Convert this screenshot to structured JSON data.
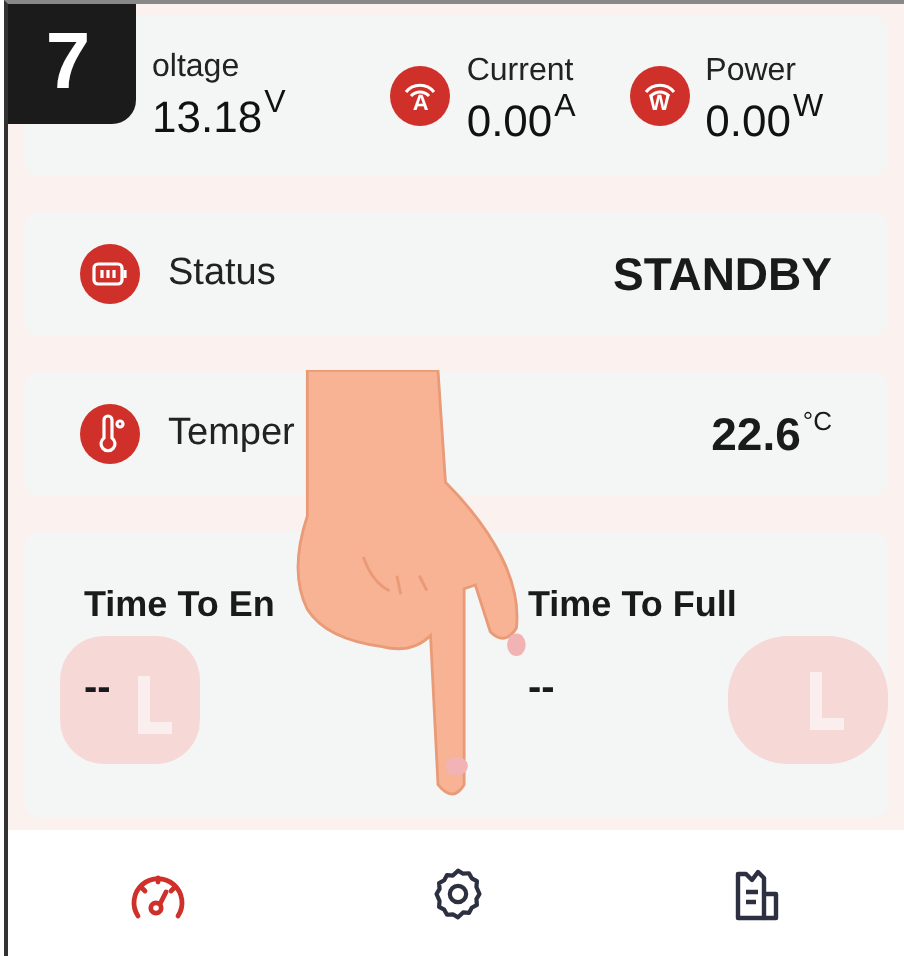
{
  "step_badge": "7",
  "metrics": [
    {
      "kind": "voltage",
      "label": "oltage",
      "value": "13.18",
      "unit": "V"
    },
    {
      "kind": "current",
      "label": "Current",
      "symbol": "A",
      "value": "0.00",
      "unit": "A"
    },
    {
      "kind": "power",
      "label": "Power",
      "symbol": "W",
      "value": "0.00",
      "unit": "W"
    }
  ],
  "rows": [
    {
      "kind": "status",
      "label": "Status",
      "value": "STANDBY"
    },
    {
      "kind": "temperature",
      "label": "Temper",
      "value": "22.6",
      "unit": "°C"
    }
  ],
  "times": [
    {
      "label": "Time To En",
      "value": "--"
    },
    {
      "label": "Time To Full",
      "value": "--"
    }
  ],
  "nav": [
    {
      "kind": "dashboard",
      "selected": true
    },
    {
      "kind": "settings",
      "selected": false
    },
    {
      "kind": "report",
      "selected": false
    }
  ]
}
